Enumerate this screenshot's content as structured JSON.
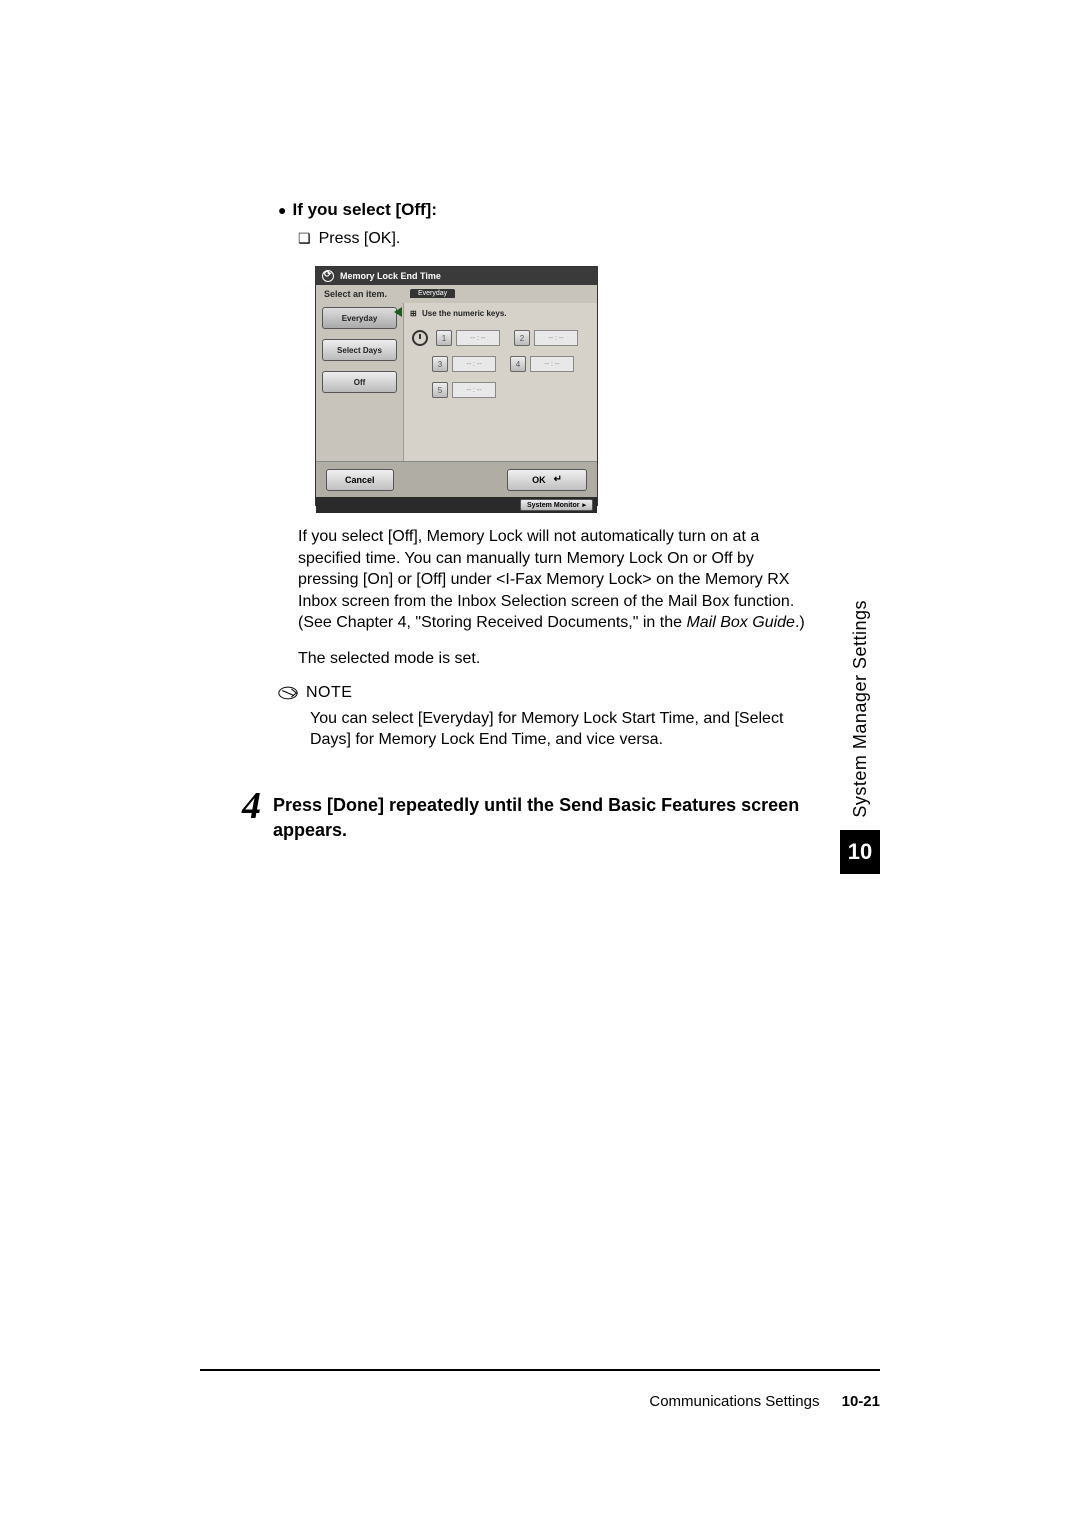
{
  "section": {
    "bullet_heading": "If you select [Off]:",
    "sub_bullet": "Press [OK]."
  },
  "screenshot": {
    "title": "Memory Lock End Time",
    "subtitle": "Select an item.",
    "tabs": {
      "everyday": "Everyday",
      "select_days": "Select Days",
      "off": "Off"
    },
    "right_tab": "Everyday",
    "hint": "Use the numeric keys.",
    "slots": {
      "n1": "1",
      "n2": "2",
      "n3": "3",
      "n4": "4",
      "n5": "5",
      "time": "-- : --"
    },
    "cancel": "Cancel",
    "ok": "OK",
    "system_monitor": "System Monitor"
  },
  "paragraphs": {
    "p1a": "If you select [Off], Memory Lock will not automatically turn on at a specified time. You can manually turn Memory Lock On or Off by pressing [On] or [Off] under <I-Fax Memory Lock> on the Memory RX Inbox screen from the Inbox Selection screen of the Mail Box function. (See Chapter 4, \"Storing Received Documents,\" in the ",
    "p1b": "Mail Box Guide",
    "p1c": ".)",
    "p2": "The selected mode is set."
  },
  "note": {
    "label": "NOTE",
    "text": "You can select [Everyday] for Memory Lock Start Time, and [Select Days] for Memory Lock End Time, and vice versa."
  },
  "step": {
    "num": "4",
    "text": "Press [Done] repeatedly until the Send Basic Features screen appears."
  },
  "sidebar": {
    "text": "System Manager Settings",
    "chapter": "10"
  },
  "footer": {
    "section": "Communications Settings",
    "page": "10-21"
  }
}
